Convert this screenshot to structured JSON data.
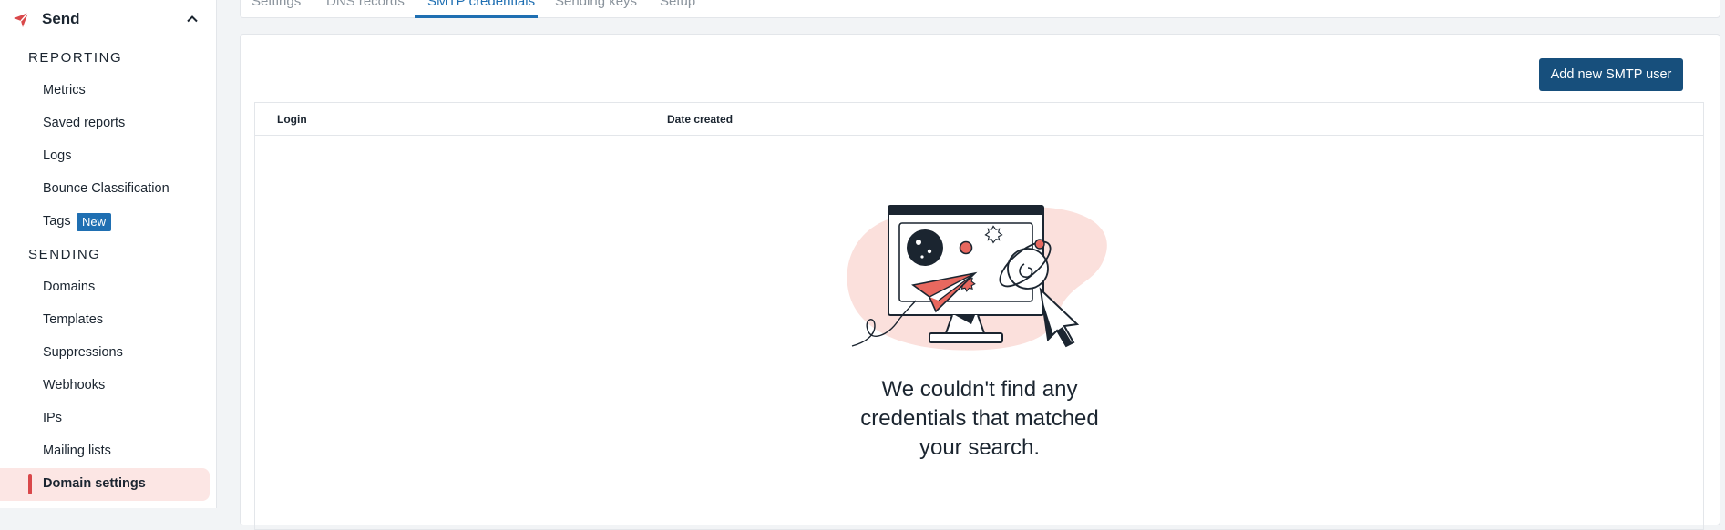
{
  "sidebar": {
    "section_title": "Send",
    "reporting_heading": "REPORTING",
    "reporting_items": [
      {
        "label": "Metrics"
      },
      {
        "label": "Saved reports"
      },
      {
        "label": "Logs"
      },
      {
        "label": "Bounce Classification"
      },
      {
        "label": "Tags",
        "badge": "New"
      }
    ],
    "sending_heading": "SENDING",
    "sending_items": [
      {
        "label": "Domains"
      },
      {
        "label": "Templates"
      },
      {
        "label": "Suppressions"
      },
      {
        "label": "Webhooks"
      },
      {
        "label": "IPs"
      },
      {
        "label": "Mailing lists"
      },
      {
        "label": "Domain settings",
        "active": true
      }
    ]
  },
  "tabs": [
    {
      "label": "Settings"
    },
    {
      "label": "DNS records"
    },
    {
      "label": "SMTP credentials",
      "active": true
    },
    {
      "label": "Sending keys"
    },
    {
      "label": "Setup"
    }
  ],
  "main": {
    "add_button_label": "Add new SMTP user",
    "table": {
      "columns": [
        "Login",
        "Date created"
      ],
      "rows": []
    },
    "empty_state": {
      "illustration": "monitor-paper-plane-illustration",
      "message": "We couldn't find any credentials that matched your search."
    }
  },
  "colors": {
    "accent": "#1f6fb2",
    "primary_button": "#174f7c",
    "active_nav_bg": "#fce6e4",
    "active_nav_marker": "#d9484a"
  }
}
